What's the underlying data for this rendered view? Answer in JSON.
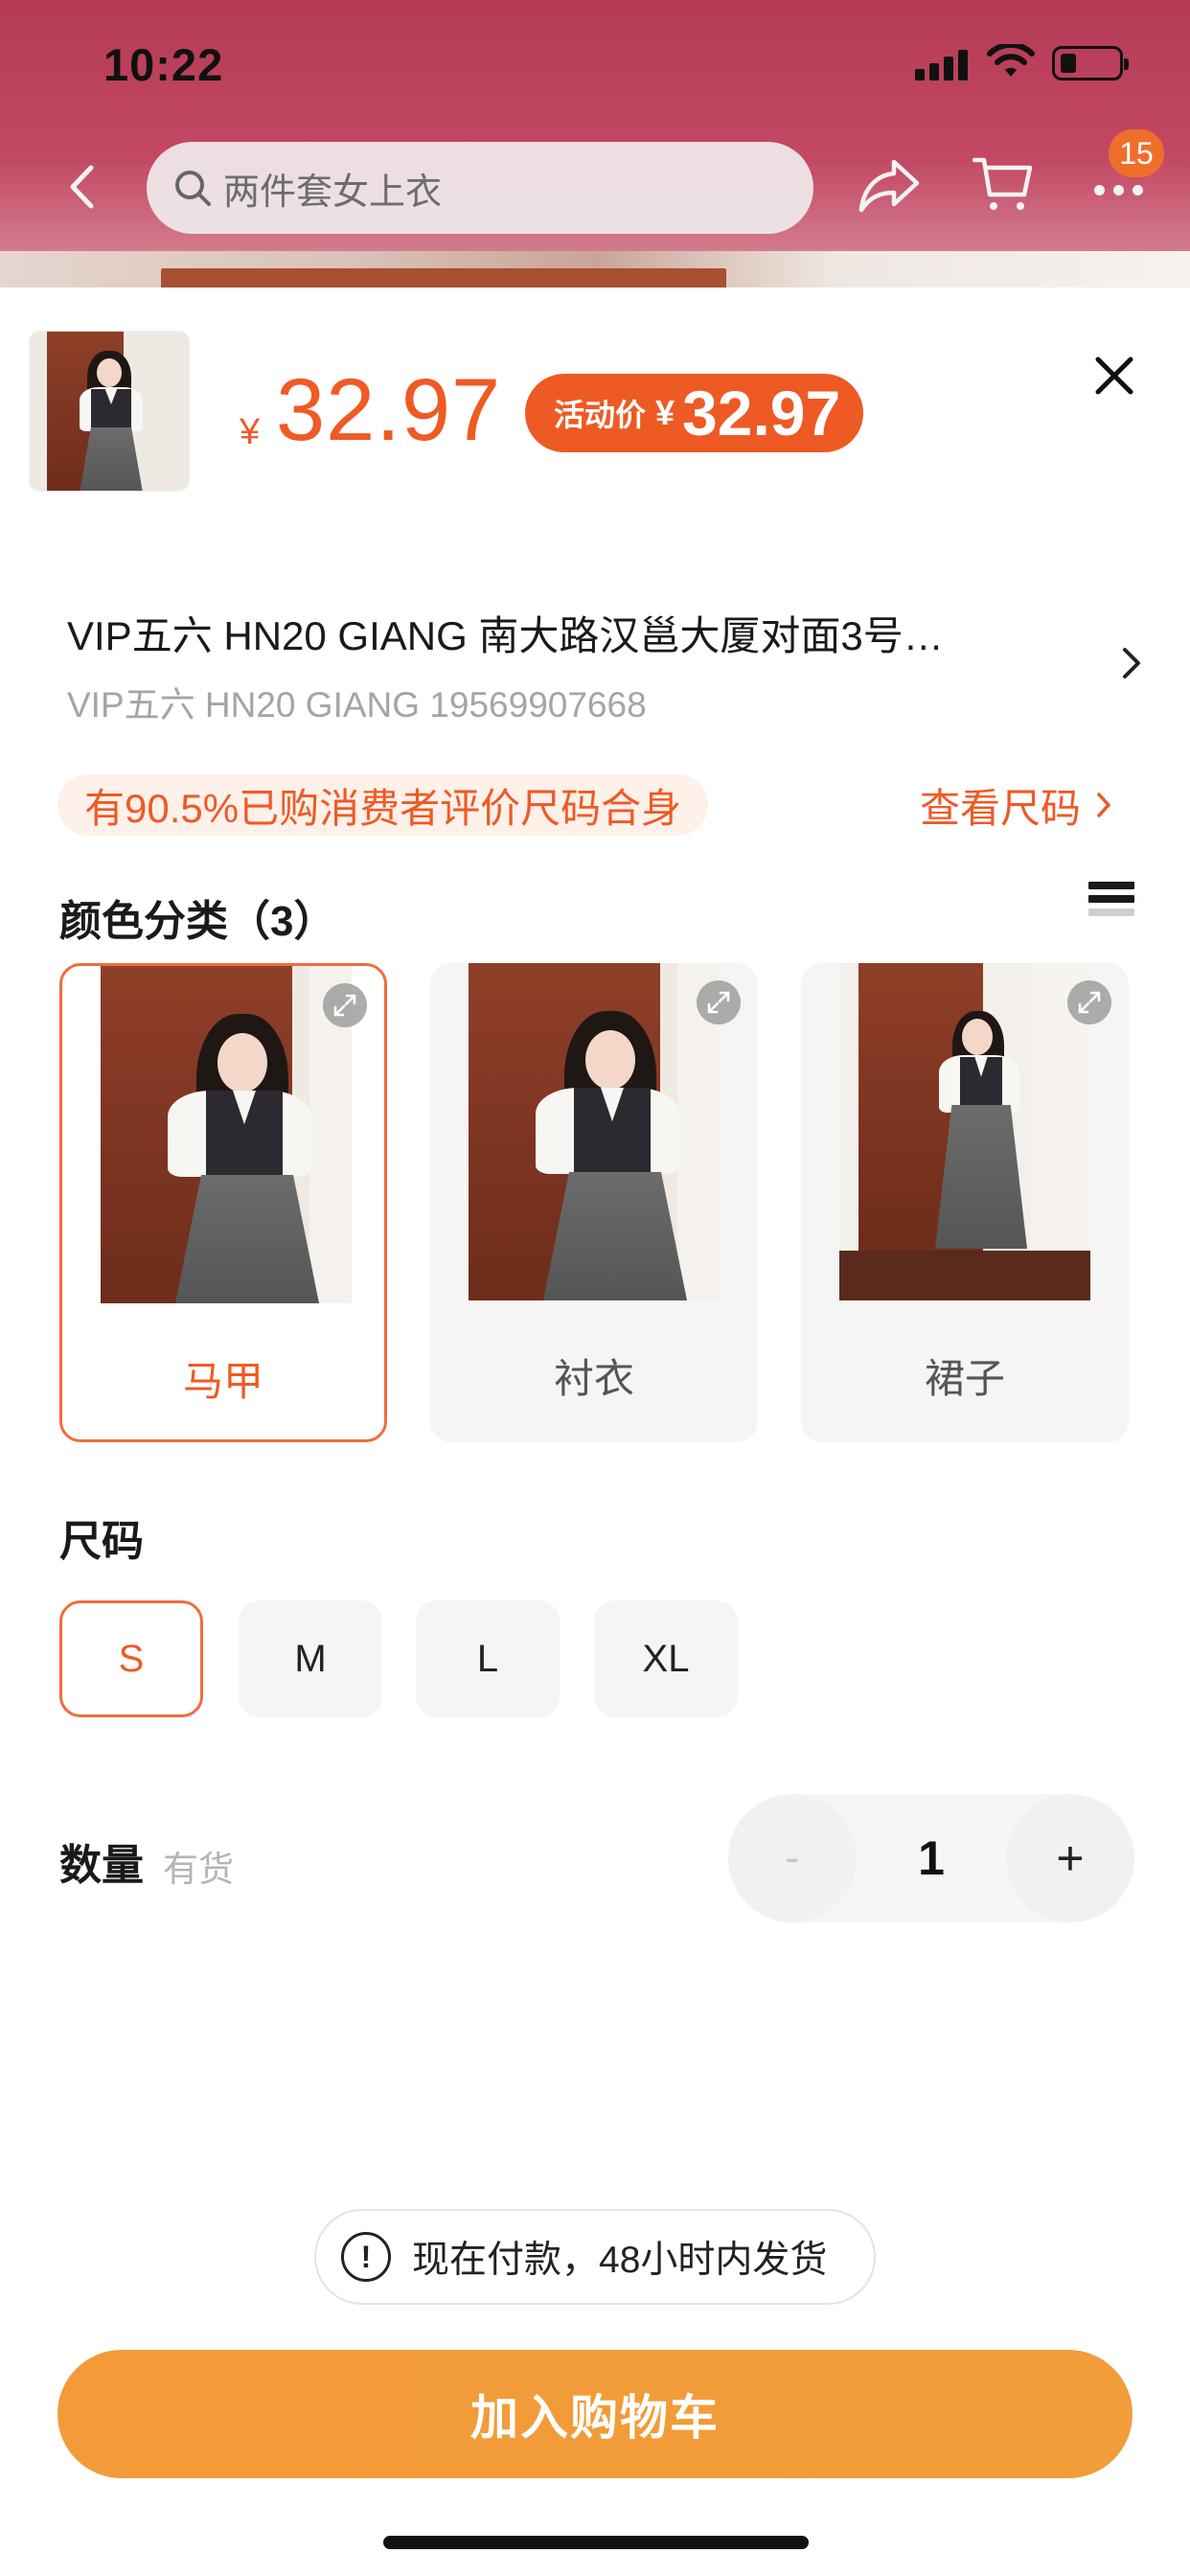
{
  "status_bar": {
    "time": "10:22"
  },
  "header": {
    "search_query": "两件套女上衣",
    "cart_badge": "15",
    "icons": [
      "back-icon",
      "search-icon",
      "share-icon",
      "cart-icon",
      "more-icon"
    ]
  },
  "product": {
    "price_symbol": "¥",
    "price": "32.97",
    "promo_label": "活动价",
    "promo_symbol": "¥",
    "promo_price": "32.97"
  },
  "address": {
    "line1": "VIP五六 HN20 GIANG 南大路汉邕大厦对面3号…",
    "line2": "VIP五六  HN20 GIANG 19569907668"
  },
  "fit": {
    "tag": "有90.5%已购消费者评价尺码合身",
    "size_chart_link": "查看尺码"
  },
  "color_section": {
    "title": "颜色分类（3）",
    "options": [
      {
        "label": "马甲",
        "selected": true
      },
      {
        "label": "衬衣",
        "selected": false
      },
      {
        "label": "裙子",
        "selected": false
      }
    ]
  },
  "size_section": {
    "title": "尺码",
    "options": [
      {
        "label": "S",
        "selected": true
      },
      {
        "label": "M",
        "selected": false
      },
      {
        "label": "L",
        "selected": false
      },
      {
        "label": "XL",
        "selected": false
      }
    ]
  },
  "quantity": {
    "label": "数量",
    "stock": "有货",
    "minus": "-",
    "value": "1",
    "plus": "+"
  },
  "notice": {
    "icon": "!",
    "text": "现在付款，48小时内发货"
  },
  "cta": {
    "add_to_cart": "加入购物车"
  },
  "colors": {
    "accent": "#ef5a25",
    "cta": "#f29b38",
    "header_bg": "#b53a55"
  }
}
